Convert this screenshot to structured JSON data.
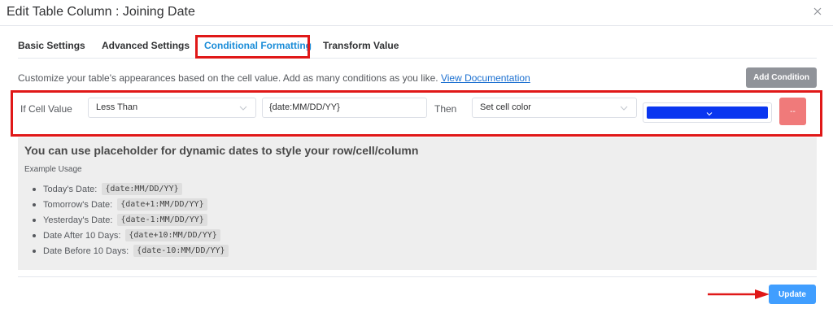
{
  "dialog": {
    "title": "Edit Table Column : Joining Date"
  },
  "tabs": [
    {
      "label": "Basic Settings",
      "active": false
    },
    {
      "label": "Advanced Settings",
      "active": false
    },
    {
      "label": "Conditional Formatting",
      "active": true
    },
    {
      "label": "Transform Value",
      "active": false
    }
  ],
  "description": {
    "text": "Customize your table's appearances based on the cell value. Add as many conditions as you like.",
    "link_text": "View Documentation"
  },
  "add_condition_label": "Add Condition",
  "condition": {
    "if_label": "If Cell Value",
    "operator": "Less Than",
    "value": "{date:MM/DD/YY}",
    "then_label": "Then",
    "action": "Set cell color",
    "color": "#0a36f0",
    "remove_label": "--"
  },
  "info": {
    "title": "You can use placeholder for dynamic dates to style your row/cell/column",
    "subtitle": "Example Usage",
    "items": [
      {
        "label": "Today's Date:",
        "code": "{date:MM/DD/YY}"
      },
      {
        "label": "Tomorrow's Date:",
        "code": "{date+1:MM/DD/YY}"
      },
      {
        "label": "Yesterday's Date:",
        "code": "{date-1:MM/DD/YY}"
      },
      {
        "label": "Date After 10 Days:",
        "code": "{date+10:MM/DD/YY}"
      },
      {
        "label": "Date Before 10 Days:",
        "code": "{date-10:MM/DD/YY}"
      }
    ]
  },
  "update_label": "Update",
  "colors": {
    "accent": "#1a8cd8",
    "highlight": "#e01818",
    "remove": "#f07a7a",
    "update": "#409eff"
  },
  "icons": {
    "close": "close-icon",
    "chevron": "chevron-down-icon",
    "arrow": "arrow-right-icon"
  }
}
